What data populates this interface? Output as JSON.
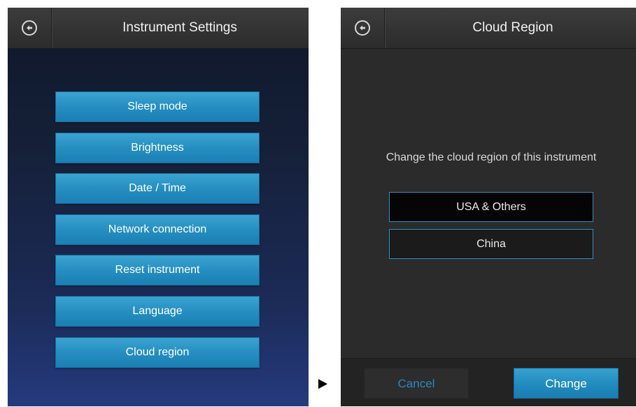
{
  "left_screen": {
    "title": "Instrument Settings",
    "back_icon": "arrow-left-circle-icon",
    "menu_items": [
      {
        "label": "Sleep mode"
      },
      {
        "label": "Brightness"
      },
      {
        "label": "Date / Time"
      },
      {
        "label": "Network connection"
      },
      {
        "label": "Reset instrument"
      },
      {
        "label": "Language"
      },
      {
        "label": "Cloud region"
      }
    ]
  },
  "transition_icon": "play-triangle-icon",
  "right_screen": {
    "title": "Cloud Region",
    "back_icon": "arrow-left-circle-icon",
    "prompt": "Change the cloud region of this instrument",
    "options": [
      {
        "label": "USA & Others",
        "selected": true
      },
      {
        "label": "China",
        "selected": false
      }
    ],
    "cancel_label": "Cancel",
    "change_label": "Change"
  },
  "colors": {
    "accent_blue": "#248dc0",
    "titlebar": "#333333",
    "dark_panel": "#2b2b2b",
    "left_bg_bottom": "#253a7e"
  }
}
